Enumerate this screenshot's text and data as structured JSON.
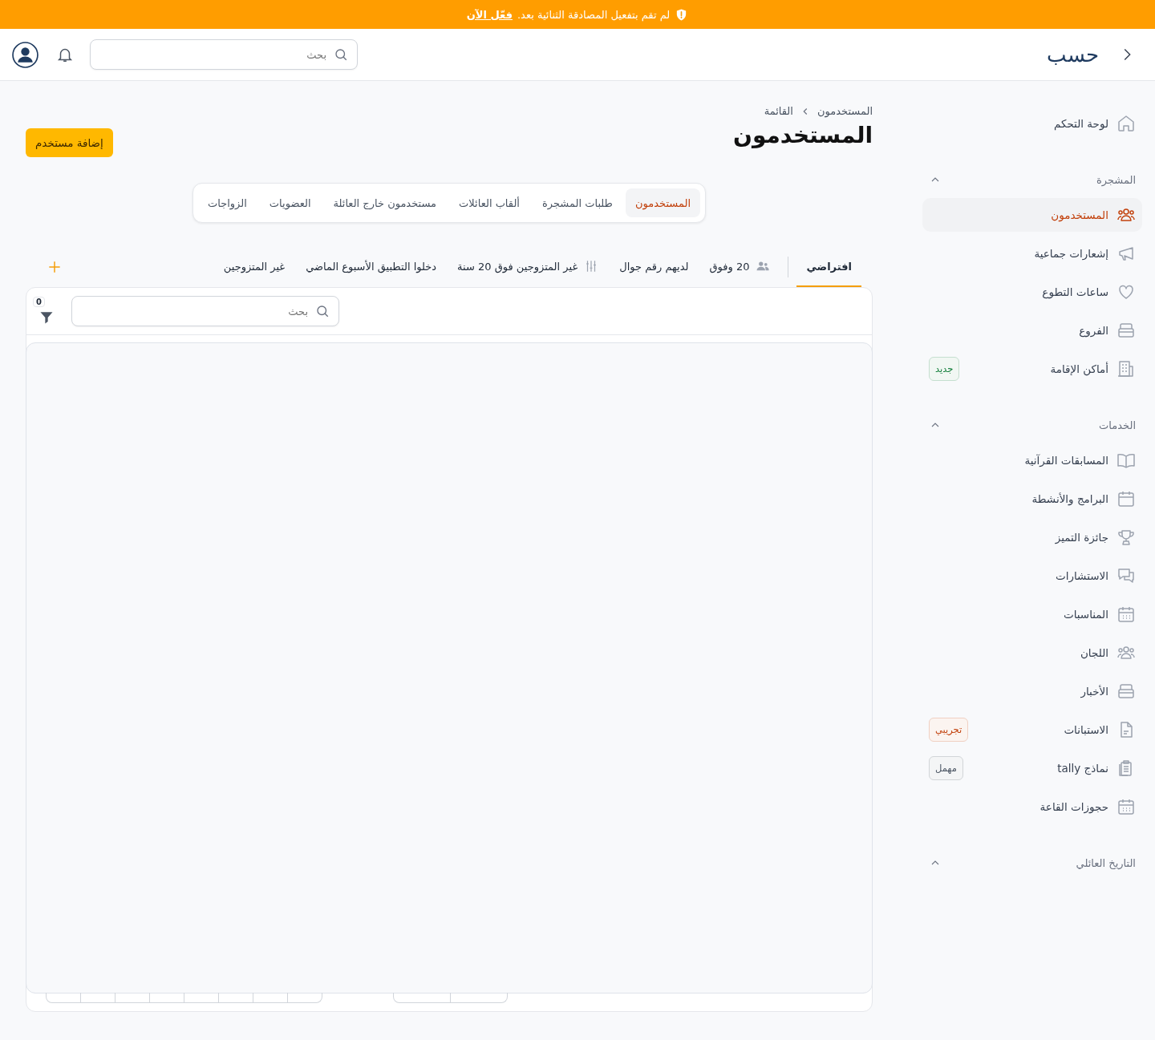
{
  "banner": {
    "text": "لم تقم بتفعيل المصادقة الثنائية بعد.",
    "link": "فعّل الآن"
  },
  "header": {
    "logo": "حسب",
    "search": {
      "placeholder": "بحث"
    }
  },
  "sidebar": {
    "items": [
      {
        "label": "لوحة التحكم",
        "selected": false
      }
    ],
    "sections": [
      {
        "title": "المشجرة",
        "expanded": true,
        "items": [
          {
            "label": "المستخدمون",
            "selected": true
          },
          {
            "label": "إشعارات جماعية",
            "selected": false
          },
          {
            "label": "ساعات التطوع",
            "selected": false
          },
          {
            "label": "الفروع",
            "selected": false
          },
          {
            "label": "أماكن الإقامة",
            "selected": false,
            "badge": {
              "label": "جديد",
              "color": "#15803d"
            }
          }
        ]
      },
      {
        "title": "الخدمات",
        "expanded": true,
        "items": [
          {
            "label": "المسابقات القرآنية",
            "selected": false
          },
          {
            "label": "البرامج والأنشطة",
            "selected": false
          },
          {
            "label": "جائزة التميز",
            "selected": false
          },
          {
            "label": "الاستشارات",
            "selected": false
          },
          {
            "label": "المناسبات",
            "selected": false
          },
          {
            "label": "اللجان",
            "selected": false
          },
          {
            "label": "الأخبار",
            "selected": false
          },
          {
            "label": "الاستبانات",
            "selected": false,
            "badge": {
              "label": "تجريبي",
              "color": "#c2410c"
            }
          },
          {
            "label": "نماذج tally",
            "selected": false,
            "badge": {
              "label": "مهمل",
              "color": "#4b5563"
            }
          },
          {
            "label": "حجوزات القاعة",
            "selected": false
          }
        ]
      },
      {
        "title": "التاريخ العائلي",
        "expanded": true
      }
    ]
  },
  "breadcrumb": [
    "المستخدمون",
    "القائمة"
  ],
  "title": "المستخدمون",
  "add_button": "إضافة مستخدم",
  "tabs": [
    {
      "label": "المستخدمون",
      "selected": true
    },
    {
      "label": "طلبات المشجرة",
      "selected": false
    },
    {
      "label": "ألقاب العائلات",
      "selected": false
    },
    {
      "label": "مستخدمون خارج العائلة",
      "selected": false
    },
    {
      "label": "العضويات",
      "selected": false
    },
    {
      "label": "الزواجات",
      "selected": false
    }
  ],
  "views": [
    {
      "label": "افتراضي",
      "selected": true,
      "kind": "default"
    },
    {
      "label": "20 وفوق",
      "selected": false,
      "kind": "people"
    },
    {
      "label": "لديهم رقم جوال",
      "selected": false,
      "kind": "plain"
    },
    {
      "label": "غير المتزوجين فوق 20 سنة",
      "selected": false,
      "kind": "filter"
    },
    {
      "label": "دخلوا التطبيق الأسبوع الماضي",
      "selected": false,
      "kind": "plain"
    },
    {
      "label": "غير المتزوجين",
      "selected": false,
      "kind": "plain"
    }
  ],
  "table": {
    "search": {
      "placeholder": "بحث"
    },
    "filter_count": "0"
  }
}
